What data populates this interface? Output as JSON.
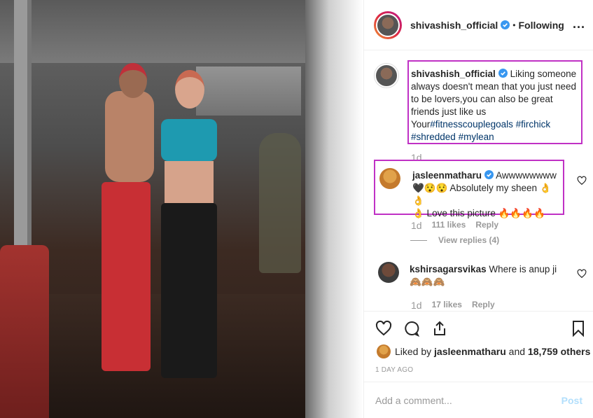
{
  "header": {
    "username": "shivashish_official",
    "separator": "•",
    "follow_state": "Following",
    "more": "..."
  },
  "caption": {
    "username": "shivashish_official",
    "text": "Liking someone always doesn't mean that you just need to be lovers,you can also be great friends just like us Your",
    "hashtags": [
      "#fitnesscouplegoals",
      "#firchick",
      "#shredded",
      "#mylean"
    ],
    "time": "1d"
  },
  "comments": [
    {
      "username": "jasleenmatharu",
      "text_line1": "Awwwwwwww",
      "text_line2": "🖤😯😯 Absolutely my sheen 👌👌",
      "text_line3": "👌 Love this picture 🔥🔥🔥🔥",
      "time": "1d",
      "likes": "111 likes",
      "reply": "Reply",
      "view_replies": "View replies (4)"
    },
    {
      "username": "kshirsagarsvikas",
      "text": "Where is anup ji 🙈🙈🙈",
      "time": "1d",
      "likes": "17 likes",
      "reply": "Reply"
    }
  ],
  "likes": {
    "prefix": "Liked by",
    "user": "jasleenmatharu",
    "and": "and",
    "others": "18,759 others"
  },
  "time_ago": "1 DAY AGO",
  "add_comment": {
    "placeholder": "Add a comment...",
    "post_label": "Post"
  },
  "colors": {
    "highlight_box": "#c031c5",
    "hashtag": "#003569",
    "verified": "#3897f0",
    "post_disabled": "#b2dffc"
  }
}
